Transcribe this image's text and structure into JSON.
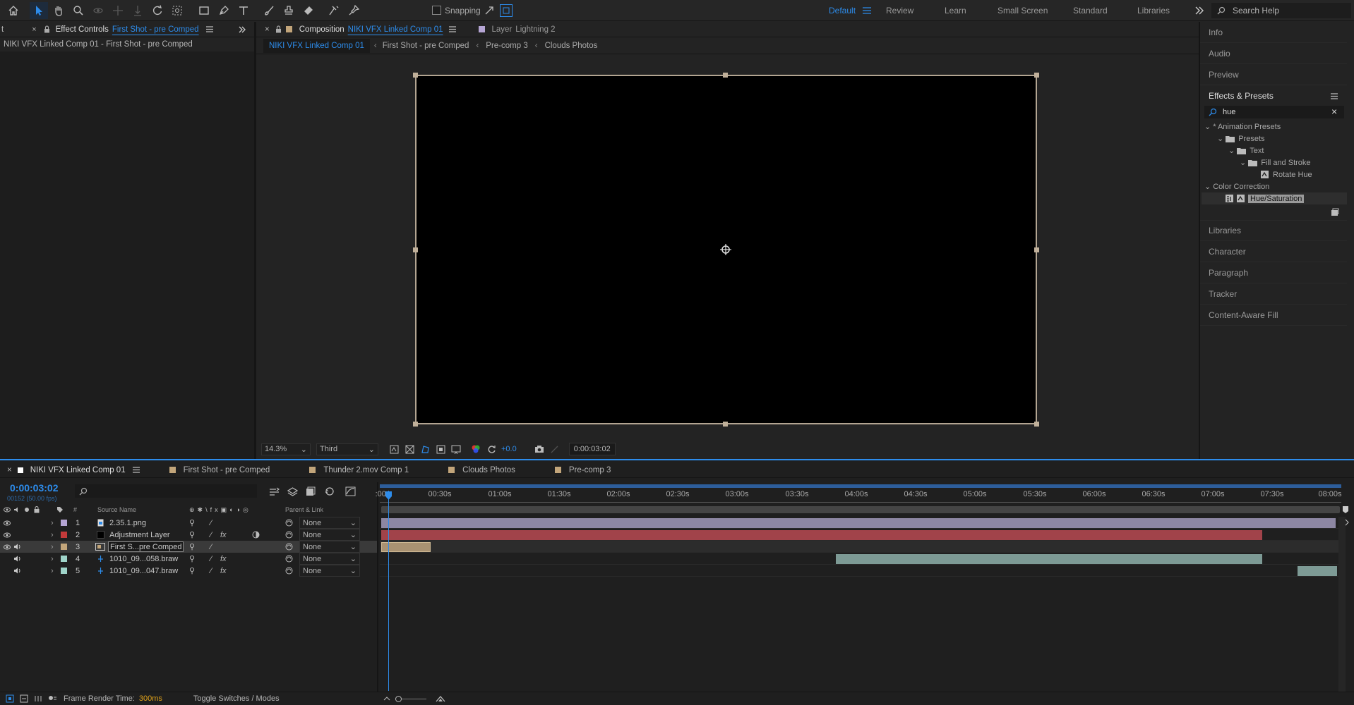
{
  "toolbar": {
    "snapping_label": "Snapping",
    "workspaces": [
      "Default",
      "Review",
      "Learn",
      "Small Screen",
      "Standard",
      "Libraries"
    ],
    "active_workspace": "Default",
    "search_placeholder": "Search Help"
  },
  "effect_controls": {
    "tab_prefix": "t",
    "tab_label": "Effect Controls",
    "tab_target": "First Shot - pre Comped",
    "header": "NIKI VFX Linked Comp 01 - First Shot - pre Comped"
  },
  "composition_panel": {
    "tab_label": "Composition",
    "tab_target": "NIKI VFX Linked Comp 01",
    "layer_tab_label": "Layer",
    "layer_tab_target": "Lightning 2",
    "breadcrumbs": [
      "NIKI VFX Linked Comp 01",
      "First Shot - pre Comped",
      "Pre-comp 3",
      "Clouds Photos"
    ],
    "zoom": "14.3%",
    "resolution": "Third",
    "exposure": "+0.0",
    "timecode": "0:00:03:02"
  },
  "right_panel": {
    "items_top": [
      "Info",
      "Audio",
      "Preview"
    ],
    "effects_title": "Effects & Presets",
    "search_value": "hue",
    "tree": [
      {
        "label": "* Animation Presets",
        "level": 0,
        "type": "group"
      },
      {
        "label": "Presets",
        "level": 1,
        "type": "folder"
      },
      {
        "label": "Text",
        "level": 2,
        "type": "folder"
      },
      {
        "label": "Fill and Stroke",
        "level": 3,
        "type": "folder"
      },
      {
        "label": "Rotate Hue",
        "level": 4,
        "type": "preset"
      },
      {
        "label": "Color Correction",
        "level": 0,
        "type": "group"
      },
      {
        "label": "Hue/Saturation",
        "level": 1,
        "type": "effect",
        "selected": true
      }
    ],
    "items_bottom": [
      "Libraries",
      "Character",
      "Paragraph",
      "Tracker",
      "Content-Aware Fill"
    ]
  },
  "timeline": {
    "tabs": [
      {
        "label": "NIKI VFX Linked Comp 01",
        "color": "#ffffff",
        "active": true
      },
      {
        "label": "First Shot - pre Comped",
        "color": "#c2a57a"
      },
      {
        "label": "Thunder 2.mov Comp 1",
        "color": "#c2a57a"
      },
      {
        "label": "Clouds Photos",
        "color": "#c2a57a"
      },
      {
        "label": "Pre-comp 3",
        "color": "#c2a57a"
      }
    ],
    "timecode": "0:00:03:02",
    "frame_info": "00152 (50.00 fps)",
    "columns": {
      "source_name": "Source Name",
      "number": "#",
      "parent": "Parent & Link"
    },
    "ruler": [
      ":00s",
      "00:30s",
      "01:00s",
      "01:30s",
      "02:00s",
      "02:30s",
      "03:00s",
      "03:30s",
      "04:00s",
      "04:30s",
      "05:00s",
      "05:30s",
      "06:00s",
      "06:30s",
      "07:00s",
      "07:30s",
      "08:00s"
    ],
    "layers": [
      {
        "num": "1",
        "name": "2.35.1.png",
        "label_color": "#b5a5d4",
        "parent": "None",
        "fx": false,
        "video": true,
        "audio": false
      },
      {
        "num": "2",
        "name": "Adjustment Layer",
        "label_color": "#c43a3a",
        "parent": "None",
        "fx": true,
        "video": true,
        "audio": false
      },
      {
        "num": "3",
        "name": "First S...pre Comped",
        "label_color": "#c2a57a",
        "parent": "None",
        "fx": false,
        "video": true,
        "audio": true,
        "selected": true
      },
      {
        "num": "4",
        "name": "1010_09...058.braw",
        "label_color": "#9fd4c9",
        "parent": "None",
        "fx": true,
        "video": false,
        "audio": true
      },
      {
        "num": "5",
        "name": "1010_09...047.braw",
        "label_color": "#9fd4c9",
        "parent": "None",
        "fx": true,
        "video": false,
        "audio": true
      }
    ],
    "footer": {
      "render_label": "Frame Render Time:",
      "render_value": "300ms",
      "toggle_label": "Toggle Switches / Modes"
    }
  }
}
